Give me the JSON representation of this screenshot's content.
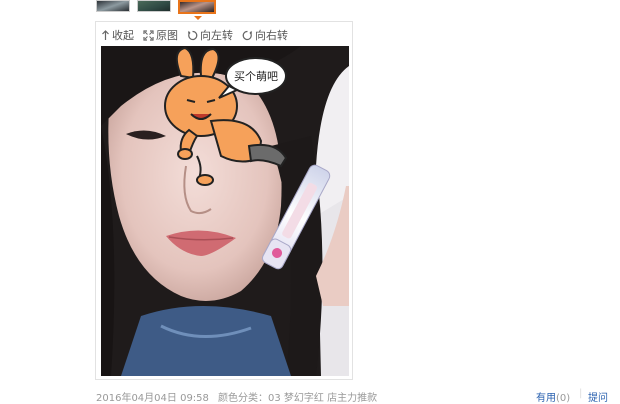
{
  "thumbnails": [
    {
      "label": "thumb-1",
      "selected": false
    },
    {
      "label": "thumb-2",
      "selected": false
    },
    {
      "label": "thumb-3",
      "selected": true
    }
  ],
  "toolbar": {
    "collapse": "收起",
    "original": "原图",
    "rotate_left": "向左转",
    "rotate_right": "向右转"
  },
  "photo": {
    "sticker_text": "买个萌吧",
    "accent_color": "#e8741a"
  },
  "footer": {
    "date": "2016年04月04日 09:58",
    "spec": "颜色分类：03 梦幻字红 店主力推款",
    "useful_label": "有用",
    "useful_count": "(0)",
    "separator": "|",
    "ask_label": "提问"
  }
}
